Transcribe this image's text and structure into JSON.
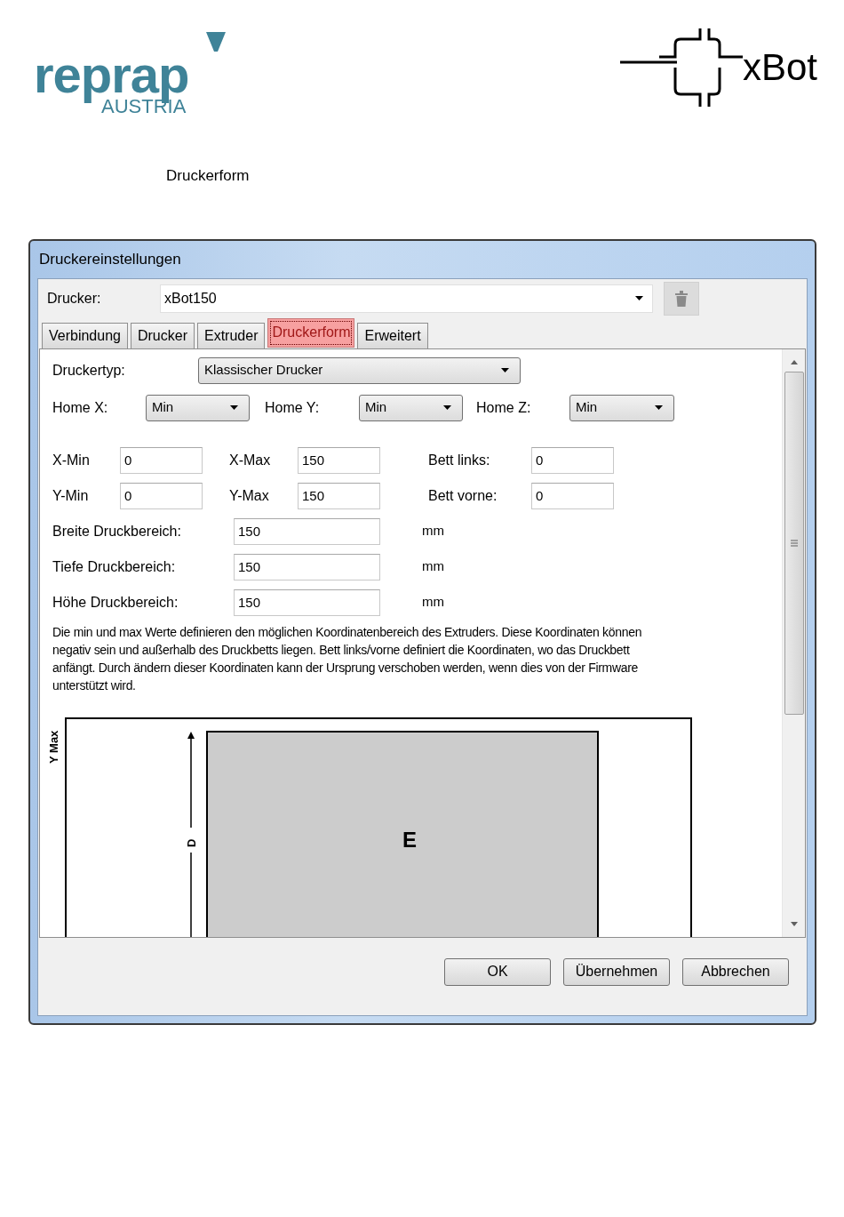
{
  "header": {
    "logo_left": {
      "word": "reprap",
      "sub": "AUSTRIA"
    },
    "logo_right": "xBot",
    "heading": "Druckerform"
  },
  "dialog": {
    "title": "Druckereinstellungen",
    "printer": {
      "label": "Drucker:",
      "value": "xBot150"
    },
    "tabs": [
      {
        "label": "Verbindung",
        "selected": false
      },
      {
        "label": "Drucker",
        "selected": false
      },
      {
        "label": "Extruder",
        "selected": false
      },
      {
        "label": "Druckerform",
        "selected": true
      },
      {
        "label": "Erweitert",
        "selected": false
      }
    ],
    "printer_type": {
      "label": "Druckertyp:",
      "value": "Klassischer Drucker"
    },
    "home": [
      {
        "label": "Home X:",
        "value": "Min"
      },
      {
        "label": "Home Y:",
        "value": "Min"
      },
      {
        "label": "Home Z:",
        "value": "Min"
      }
    ],
    "coordinate_rows": [
      [
        {
          "label": "X-Min",
          "value": "0"
        },
        {
          "label": "X-Max",
          "value": "150"
        },
        {
          "label": "Bett links:",
          "value": "0"
        }
      ],
      [
        {
          "label": "Y-Min",
          "value": "0"
        },
        {
          "label": "Y-Max",
          "value": "150"
        },
        {
          "label": "Bett vorne:",
          "value": "0"
        }
      ]
    ],
    "area_rows": [
      {
        "label": "Breite Druckbereich:",
        "value": "150",
        "unit": "mm"
      },
      {
        "label": "Tiefe Druckbereich:",
        "value": "150",
        "unit": "mm"
      },
      {
        "label": "Höhe Druckbereich:",
        "value": "150",
        "unit": "mm"
      }
    ],
    "description": "Die min und max Werte definieren den möglichen Koordinatenbereich des Extruders. Diese Koordinaten können negativ sein und außerhalb des Druckbetts liegen. Bett links/vorne definiert die Koordinaten, wo das Druckbett anfängt. Durch ändern dieser Koordinaten kann der Ursprung verschoben werden, wenn dies von der Firmware unterstützt wird.",
    "diagram": {
      "y_label": "Y Max",
      "dimension_label": "D",
      "bed_label": "E"
    },
    "buttons": [
      "OK",
      "Übernehmen",
      "Abbrechen"
    ]
  }
}
